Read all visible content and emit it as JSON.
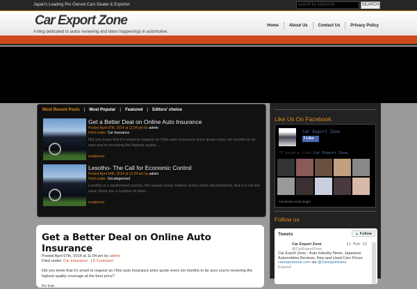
{
  "topbar": {
    "tagline": "Japan's Leading Pre Owned Cars Dealer & Exporter",
    "search_placeholder": "search by keywords",
    "search_button": "SEARCH"
  },
  "header": {
    "title": "Car Export Zone",
    "description": "A blog dedicated to autos reviewing and latest happenings in automotive."
  },
  "nav": [
    "Home",
    "About Us",
    "Contact Us",
    "Privacy Policy"
  ],
  "featured": {
    "tabs": [
      "Most Recent Posts",
      "Most Popular",
      "Featured",
      "Editors' choice"
    ],
    "posts": [
      {
        "title": "Get a Better Deal on Online Auto Insurance",
        "posted": "Posted April 07th, 2014 at 11:04 pm by",
        "author": "admin",
        "filed_label": "Filed under:",
        "category": "Car Insurance",
        "excerpt": "Did you know that it's smart to request an Ohio auto insurance price quote every six months to be sure you're receiving the highest quality ...",
        "readmore": "readmore"
      },
      {
        "title": "Lesotho- The Call for Economic Control",
        "posted": "Posted April 04th, 2014 at 12:04 am by",
        "author": "admin",
        "filed_label": "Filed under:",
        "category": "Uncategorized",
        "excerpt": "Lesotho is a landlocked country, the reason many believe of the under development. But it is not the case; there are a number of other ...",
        "readmore": "readmore"
      }
    ]
  },
  "post": {
    "title": "Get a Better Deal on Online Auto Insurance",
    "posted": "Posted April 07th, 2014 at 11:04 pm by",
    "author": "admin",
    "filed_label": "Filed under:",
    "category": "Car Insurance",
    "comments": "0 Comment",
    "paragraph1": "Did you know that it's smart to request an Ohio auto insurance price quote every six months to be sure you're receiving the highest quality coverage at the best price?",
    "paragraph2": "It's true."
  },
  "sidebar": {
    "facebook": {
      "heading": "Like Us On Facebook",
      "page_name": "Car Export Zone",
      "like": "Like",
      "count_text": "73 people like",
      "count_link": "Car Export Zone.",
      "plugin": "Facebook social plugin",
      "face_colors": [
        "#333",
        "#8a5a5a",
        "#6a5040",
        "#c0a080",
        "#888",
        "#999",
        "#3a3030",
        "#c8d0e0",
        "#4a3a40",
        "#d8b8a8"
      ]
    },
    "twitter": {
      "heading": "Follow us",
      "title": "Tweets",
      "follow": "Follow",
      "name": "Car Export Zone",
      "handle": "@CarExportZone",
      "date": "21 Feb 13",
      "text": "Car Export Zone - Auto Industry News, Japanese Automobiles Reviews, New and Used Cars Prices",
      "link": "carexportzone.com",
      "via": "via",
      "mention": "@Carexportzone",
      "expand": "Expand"
    }
  }
}
